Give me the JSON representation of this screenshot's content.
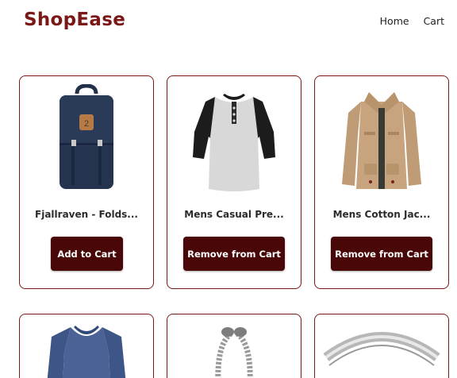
{
  "header": {
    "brand": "ShopEase",
    "nav": [
      "Home",
      "Cart"
    ]
  },
  "colors": {
    "brand": "#7a1717",
    "button": "#4a0707",
    "card_border": "#7a1717"
  },
  "products": [
    {
      "title": "Fjallraven - Folds...",
      "action": "Add to Cart",
      "image": "backpack-image"
    },
    {
      "title": "Mens Casual Pre...",
      "action": "Remove from Cart",
      "image": "henley-shirt-image"
    },
    {
      "title": "Mens Cotton Jac...",
      "action": "Remove from Cart",
      "image": "cotton-jacket-image"
    },
    {
      "image": "blue-tshirt-image"
    },
    {
      "image": "silver-bracelet-image"
    },
    {
      "image": "silver-ring-image"
    }
  ]
}
